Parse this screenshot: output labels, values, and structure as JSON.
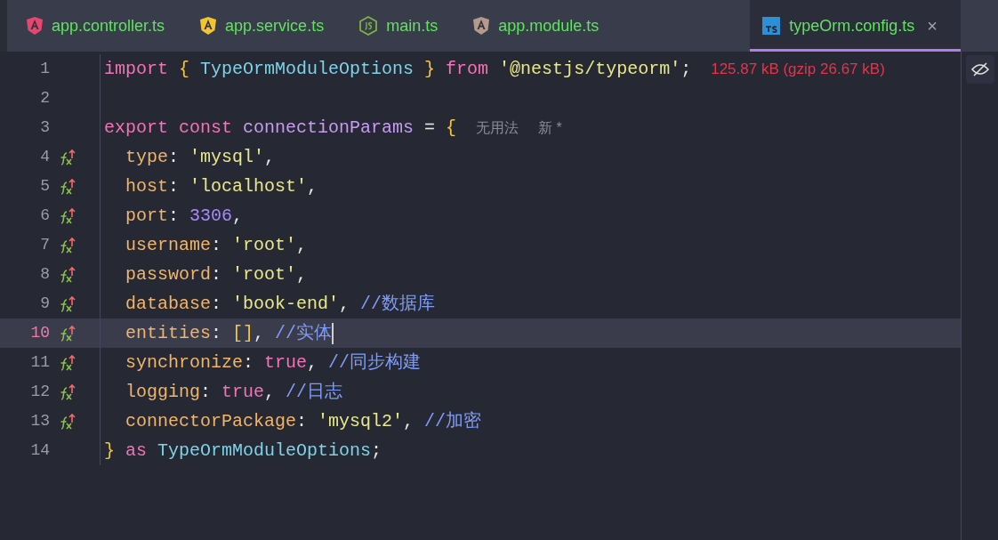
{
  "tabs": [
    {
      "label": "app.controller.ts",
      "kind": "angular",
      "color": "#e8466e",
      "selected": false
    },
    {
      "label": "app.service.ts",
      "kind": "angular",
      "color": "#f2c530",
      "selected": false
    },
    {
      "label": "main.ts",
      "kind": "node",
      "color": "#7cb342",
      "selected": false
    },
    {
      "label": "app.module.ts",
      "kind": "angular",
      "color": "#b59a8a",
      "selected": false
    },
    {
      "label": "typeOrm.config.ts",
      "kind": "ts",
      "color": "#2d8fd5",
      "selected": true,
      "close": "×"
    }
  ],
  "editor": {
    "lines": [
      {
        "number": "1",
        "gutter_icon": false,
        "current": false,
        "tokens": [
          {
            "kind": "keyword",
            "text": "import"
          },
          {
            "kind": "brace",
            "text": " {"
          },
          {
            "kind": "type",
            "text": " TypeOrmModuleOptions"
          },
          {
            "kind": "brace",
            "text": " }"
          },
          {
            "kind": "keyword",
            "text": " from"
          },
          {
            "kind": "string",
            "text": " '@nestjs/typeorm'"
          },
          {
            "kind": "plain",
            "text": ";"
          }
        ],
        "hints": [
          {
            "kind": "size",
            "text": "125.87 kB (gzip 26.67 kB)"
          }
        ]
      },
      {
        "number": "2",
        "gutter_icon": false,
        "current": false
      },
      {
        "number": "3",
        "gutter_icon": false,
        "current": false,
        "tokens": [
          {
            "kind": "keyword",
            "text": "export const"
          },
          {
            "kind": "variable",
            "text": " connectionParams"
          },
          {
            "kind": "plain",
            "text": " ="
          },
          {
            "kind": "brace",
            "text": " {"
          }
        ],
        "hints": [
          {
            "kind": "usage",
            "text": "无用法"
          },
          {
            "kind": "usage",
            "text": "新 *"
          }
        ]
      },
      {
        "number": "4",
        "gutter_icon": true,
        "current": false,
        "tokens": [
          {
            "kind": "property",
            "text": "  type"
          },
          {
            "kind": "plain",
            "text": ":"
          },
          {
            "kind": "string",
            "text": " 'mysql'"
          },
          {
            "kind": "plain",
            "text": ","
          }
        ]
      },
      {
        "number": "5",
        "gutter_icon": true,
        "current": false,
        "tokens": [
          {
            "kind": "property",
            "text": "  host"
          },
          {
            "kind": "plain",
            "text": ":"
          },
          {
            "kind": "string",
            "text": " 'localhost'"
          },
          {
            "kind": "plain",
            "text": ","
          }
        ]
      },
      {
        "number": "6",
        "gutter_icon": true,
        "current": false,
        "tokens": [
          {
            "kind": "property",
            "text": "  port"
          },
          {
            "kind": "plain",
            "text": ":"
          },
          {
            "kind": "number",
            "text": " 3306"
          },
          {
            "kind": "plain",
            "text": ","
          }
        ]
      },
      {
        "number": "7",
        "gutter_icon": true,
        "current": false,
        "tokens": [
          {
            "kind": "property",
            "text": "  username"
          },
          {
            "kind": "plain",
            "text": ":"
          },
          {
            "kind": "string",
            "text": " 'root'"
          },
          {
            "kind": "plain",
            "text": ","
          }
        ]
      },
      {
        "number": "8",
        "gutter_icon": true,
        "current": false,
        "tokens": [
          {
            "kind": "property",
            "text": "  password"
          },
          {
            "kind": "plain",
            "text": ":"
          },
          {
            "kind": "string",
            "text": " 'root'"
          },
          {
            "kind": "plain",
            "text": ","
          }
        ]
      },
      {
        "number": "9",
        "gutter_icon": true,
        "current": false,
        "tokens": [
          {
            "kind": "property",
            "text": "  database"
          },
          {
            "kind": "plain",
            "text": ":"
          },
          {
            "kind": "string",
            "text": " 'book-end'"
          },
          {
            "kind": "plain",
            "text": ","
          },
          {
            "kind": "comment",
            "text": " //数据库"
          }
        ]
      },
      {
        "number": "10",
        "gutter_icon": true,
        "current": true,
        "tokens": [
          {
            "kind": "property",
            "text": "  entities"
          },
          {
            "kind": "plain",
            "text": ":"
          },
          {
            "kind": "brace",
            "text": " []"
          },
          {
            "kind": "plain",
            "text": ","
          },
          {
            "kind": "comment",
            "text": " //实体"
          }
        ]
      },
      {
        "number": "11",
        "gutter_icon": true,
        "current": false,
        "tokens": [
          {
            "kind": "property",
            "text": "  synchronize"
          },
          {
            "kind": "plain",
            "text": ":"
          },
          {
            "kind": "keyword",
            "text": " true"
          },
          {
            "kind": "plain",
            "text": ","
          },
          {
            "kind": "comment",
            "text": " //同步构建"
          }
        ]
      },
      {
        "number": "12",
        "gutter_icon": true,
        "current": false,
        "tokens": [
          {
            "kind": "property",
            "text": "  logging"
          },
          {
            "kind": "plain",
            "text": ":"
          },
          {
            "kind": "keyword",
            "text": " true"
          },
          {
            "kind": "plain",
            "text": ","
          },
          {
            "kind": "comment",
            "text": " //日志"
          }
        ]
      },
      {
        "number": "13",
        "gutter_icon": true,
        "current": false,
        "tokens": [
          {
            "kind": "property",
            "text": "  connectorPackage"
          },
          {
            "kind": "plain",
            "text": ":"
          },
          {
            "kind": "string",
            "text": " 'mysql2'"
          },
          {
            "kind": "plain",
            "text": ","
          },
          {
            "kind": "comment",
            "text": " //加密"
          }
        ]
      },
      {
        "number": "14",
        "gutter_icon": false,
        "current": false,
        "tokens": [
          {
            "kind": "brace",
            "text": "}"
          },
          {
            "kind": "keyword",
            "text": " as"
          },
          {
            "kind": "type",
            "text": " TypeOrmModuleOptions"
          },
          {
            "kind": "plain",
            "text": ";"
          }
        ]
      }
    ]
  }
}
